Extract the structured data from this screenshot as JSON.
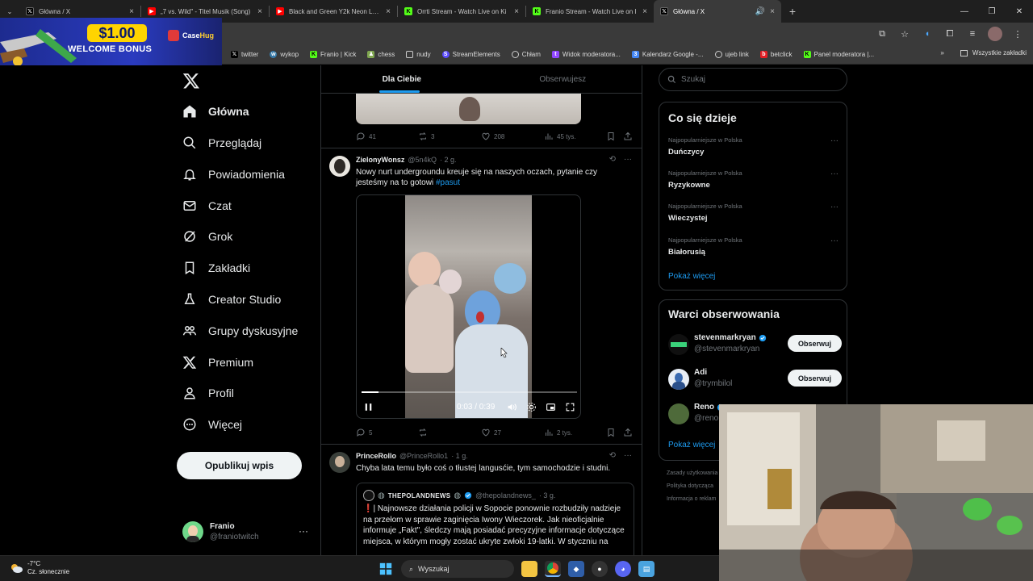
{
  "browser": {
    "tabs": [
      {
        "title": "Główna / X",
        "favicon": "x-icon",
        "color": "#000000"
      },
      {
        "title": "„7 vs. Wild\" - Titel Musik (Song)",
        "favicon": "youtube-icon",
        "color": "#ff0000"
      },
      {
        "title": "Black and Green Y2k Neon LED",
        "favicon": "youtube-icon",
        "color": "#ff0000"
      },
      {
        "title": "Orrti Stream - Watch Live on Ki",
        "favicon": "kick-icon",
        "color": "#53fc18"
      },
      {
        "title": "Franio Stream - Watch Live on I",
        "favicon": "kick-icon",
        "color": "#53fc18"
      },
      {
        "title": "Główna / X",
        "favicon": "x-icon",
        "color": "#000000"
      }
    ],
    "bookmarks": [
      {
        "label": "twitter",
        "icon": "x-icon",
        "color": "#000000"
      },
      {
        "label": "wykop",
        "icon": "wykop-icon",
        "color": "#367aa9"
      },
      {
        "label": "Franio | Kick",
        "icon": "kick-icon",
        "color": "#53fc18"
      },
      {
        "label": "chess",
        "icon": "chess-icon",
        "color": "#7fa650"
      },
      {
        "label": "nudy",
        "icon": "folder-icon",
        "color": "#555555"
      },
      {
        "label": "StreamElements",
        "icon": "streamelements-icon",
        "color": "#5b4bff"
      },
      {
        "label": "Chłam",
        "icon": "globe-icon",
        "color": "#555555"
      },
      {
        "label": "Widok moderatora...",
        "icon": "twitch-icon",
        "color": "#9146ff"
      },
      {
        "label": "Kalendarz Google -...",
        "icon": "calendar-icon",
        "color": "#4285f4"
      },
      {
        "label": "ujeb link",
        "icon": "globe-icon",
        "color": "#555555"
      },
      {
        "label": "betclick",
        "icon": "betclick-icon",
        "color": "#e31e25"
      },
      {
        "label": "Panel moderatora |...",
        "icon": "kick-icon",
        "color": "#53fc18"
      }
    ],
    "all_bookmarks": "Wszystkie zakładki"
  },
  "ad": {
    "price": "$1.00",
    "text": "WELCOME BONUS",
    "brand_a": "Case",
    "brand_b": "Hug"
  },
  "nav": {
    "items": [
      {
        "label": "Główna",
        "icon": "home-icon"
      },
      {
        "label": "Przeglądaj",
        "icon": "search-icon"
      },
      {
        "label": "Powiadomienia",
        "icon": "bell-icon"
      },
      {
        "label": "Czat",
        "icon": "mail-icon"
      },
      {
        "label": "Grok",
        "icon": "grok-icon"
      },
      {
        "label": "Zakładki",
        "icon": "bookmark-icon"
      },
      {
        "label": "Creator Studio",
        "icon": "creator-icon"
      },
      {
        "label": "Grupy dyskusyjne",
        "icon": "communities-icon"
      },
      {
        "label": "Premium",
        "icon": "x-icon"
      },
      {
        "label": "Profil",
        "icon": "person-icon"
      },
      {
        "label": "Więcej",
        "icon": "more-icon"
      }
    ],
    "post_button": "Opublikuj wpis",
    "profile": {
      "name": "Franio",
      "handle": "@franiotwitch"
    }
  },
  "timeline": {
    "tabs": [
      "Dla Ciebie",
      "Obserwujesz"
    ],
    "prev_actions": {
      "replies": "41",
      "reposts": "3",
      "likes": "208",
      "views": "45 tys."
    },
    "tweet1": {
      "name": "ZielonyWonsz",
      "handle": "@5n4kQ",
      "time": "· 2 g.",
      "text": "Nowy nurt undergroundu kreuje się na naszych oczach, pytanie czy jesteśmy na to gotowi",
      "hashtag": "#pasut",
      "video_time": "0:03 / 0:39",
      "video_progress": 0.08,
      "actions": {
        "replies": "5",
        "reposts": "",
        "likes": "27",
        "views": "2 tys."
      }
    },
    "tweet2": {
      "name": "PrinceRollo",
      "handle": "@PrinceRollo1",
      "time": "· 1 g.",
      "text": "Chyba lata temu było coś o tłustej langusćie, tym samochodzie i studni.",
      "quote": {
        "name": "THEPOLANDNEWS",
        "handle": "@thepolandnews_",
        "time": "· 3 g.",
        "mark": "❗️",
        "text": "| Najnowsze działania policji w Sopocie ponownie rozbudziły nadzieje na przełom w sprawie zaginięcia Iwony Wieczorek. Jak nieoficjalnie informuje „Fakt\", śledczy mają posiadać precyzyjne informacje dotyczące miejsca, w którym mogły zostać ukryte zwłoki 19-latki. W styczniu na"
      }
    }
  },
  "sidebar": {
    "search_placeholder": "Szukaj",
    "trends_title": "Co się dzieje",
    "trends": [
      {
        "context": "Najpopularniejsze w Polska",
        "name": "Duńczycy"
      },
      {
        "context": "Najpopularniejsze w Polska",
        "name": "Ryzykowne"
      },
      {
        "context": "Najpopularniejsze w Polska",
        "name": "Wieczystej"
      },
      {
        "context": "Najpopularniejsze w Polska",
        "name": "Białorusią"
      }
    ],
    "show_more": "Pokaż więcej",
    "follow_title": "Warci obserwowania",
    "follow": [
      {
        "name": "stevenmarkryan",
        "handle": "@stevenmarkryan",
        "verified": true,
        "button": "Obserwuj"
      },
      {
        "name": "Adi",
        "handle": "@trymbilol",
        "verified": false,
        "button": "Obserwuj"
      },
      {
        "name": "Reno",
        "handle": "@reno",
        "verified": true,
        "button": ""
      }
    ],
    "footer": [
      "Zasady użytkowania",
      "Polityka dotycząca",
      "Informacja o reklam"
    ]
  },
  "taskbar": {
    "temperature": "-7°C",
    "weather": "Cz. słonecznie",
    "search": "Wyszukaj"
  },
  "colors": {
    "accent": "#1d9bf0",
    "background": "#000000",
    "border": "#2f3336"
  }
}
